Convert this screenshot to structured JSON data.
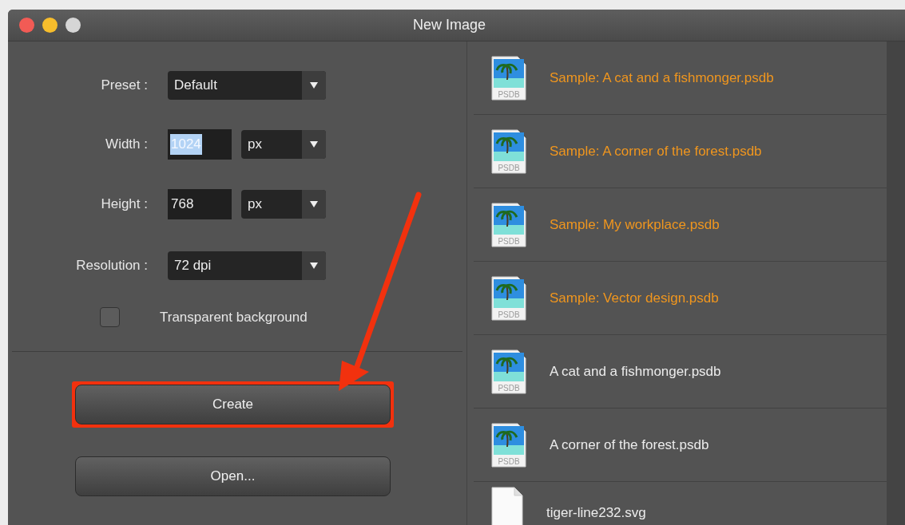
{
  "window": {
    "title": "New Image"
  },
  "form": {
    "preset": {
      "label": "Preset :",
      "value": "Default"
    },
    "width": {
      "label": "Width :",
      "value": "1024",
      "text_selected": true,
      "unit": "px"
    },
    "height": {
      "label": "Height :",
      "value": "768",
      "text_selected": false,
      "unit": "px"
    },
    "resolution": {
      "label": "Resolution :",
      "value": "72 dpi"
    },
    "transparent": {
      "label": "Transparent background",
      "checked": false
    }
  },
  "buttons": [
    {
      "label": "Create",
      "highlighted": true
    },
    {
      "label": "Open...",
      "highlighted": false
    }
  ],
  "files": [
    {
      "name": "Sample: A cat and a fishmonger.psdb",
      "kind": "sample",
      "icon_label": "PSDB"
    },
    {
      "name": "Sample: A corner of the forest.psdb",
      "kind": "sample",
      "icon_label": "PSDB"
    },
    {
      "name": "Sample: My workplace.psdb",
      "kind": "sample",
      "icon_label": "PSDB"
    },
    {
      "name": "Sample: Vector design.psdb",
      "kind": "sample",
      "icon_label": "PSDB"
    },
    {
      "name": "A cat and a fishmonger.psdb",
      "kind": "recent",
      "icon_label": "PSDB"
    },
    {
      "name": "A corner of the forest.psdb",
      "kind": "recent",
      "icon_label": "PSDB"
    },
    {
      "name": "tiger-line232.svg",
      "kind": "recent"
    }
  ]
}
